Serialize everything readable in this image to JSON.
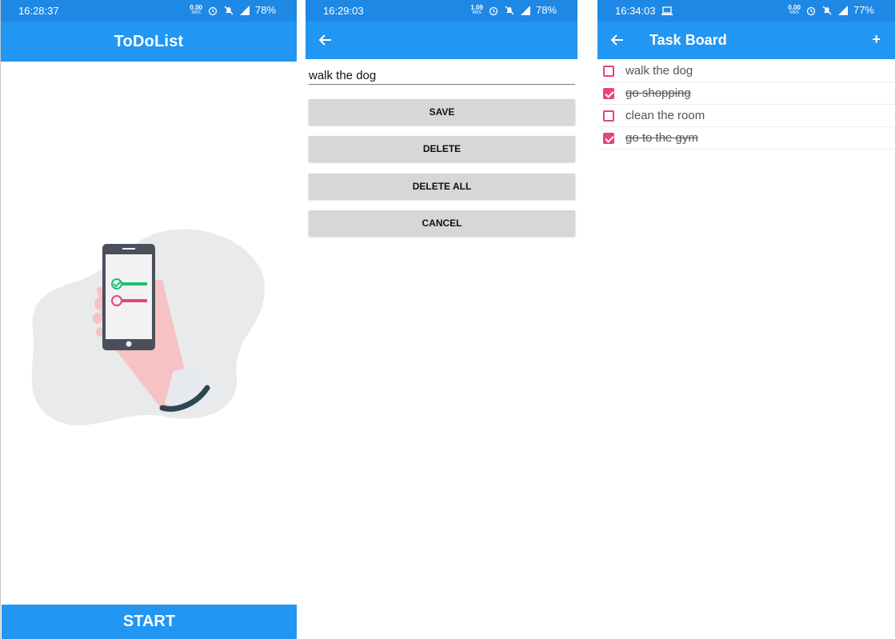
{
  "screen1": {
    "status": {
      "time": "16:28:37",
      "speed": "0.00",
      "speed_unit": "KB/S",
      "battery": "78%"
    },
    "title": "ToDoList",
    "start_label": "START"
  },
  "screen2": {
    "status": {
      "time": "16:29:03",
      "speed": "1.09",
      "speed_unit": "KB/S",
      "battery": "78%"
    },
    "field_value": "walk the dog",
    "buttons": {
      "save": "SAVE",
      "delete": "DELETE",
      "delete_all": "DELETE ALL",
      "cancel": "CANCEL"
    }
  },
  "screen3": {
    "status": {
      "time": "16:34:03",
      "speed": "0.00",
      "speed_unit": "KB/S",
      "battery": "77%"
    },
    "title": "Task Board",
    "add_label": "+",
    "tasks": [
      {
        "text": "walk the dog",
        "checked": false
      },
      {
        "text": "go shopping",
        "checked": true
      },
      {
        "text": "clean the room",
        "checked": false
      },
      {
        "text": "go to the gym",
        "checked": true
      }
    ]
  },
  "colors": {
    "primary": "#2196f3",
    "status": "#1e88e5",
    "accent": "#e64577",
    "button_gray": "#d6d7d7"
  }
}
